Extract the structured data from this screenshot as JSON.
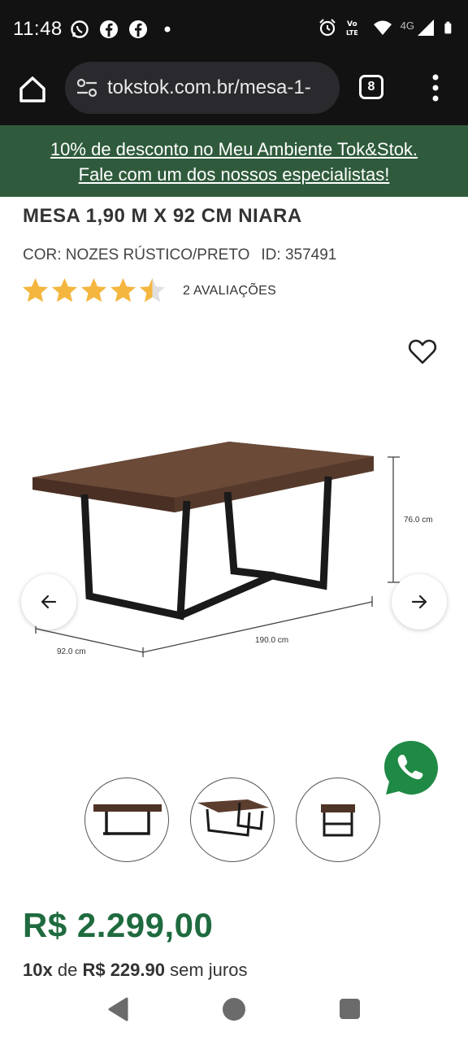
{
  "status_bar": {
    "time": "11:48",
    "left_icons": [
      "whatsapp-icon",
      "facebook-icon",
      "facebook-icon",
      "dot-icon"
    ],
    "right_icons": [
      "alarm-icon",
      "volte-icon",
      "wifi-icon",
      "4g-signal-icon",
      "battery-icon"
    ],
    "network": "4G"
  },
  "browser": {
    "url": "tokstok.com.br/mesa-1-",
    "tab_count": "8"
  },
  "promo": {
    "line1": "10% de desconto no Meu Ambiente Tok&Stok.",
    "line2": "Fale com um dos nossos especialistas!"
  },
  "product": {
    "title": "MESA 1,90 M X 92 CM NIARA",
    "color": "COR: NOZES RÚSTICO/PRETO",
    "id": "ID: 357491",
    "rating_value": 4.5,
    "rating_max": 5,
    "reviews": "2 AVALIAÇÕES",
    "dimensions": {
      "height": "76.0 cm",
      "length": "190.0 cm",
      "depth": "92.0 cm"
    },
    "thumbnail_count": 3
  },
  "price": {
    "value": "R$ 2.299,00",
    "installments_count": "10x",
    "installments_de": "de",
    "installment_value": "R$ 229.90",
    "installments_suffix": "sem juros"
  },
  "colors": {
    "brand_green": "#2f5b3c",
    "price_green": "#1f6b3f",
    "star": "#f4b63f"
  }
}
